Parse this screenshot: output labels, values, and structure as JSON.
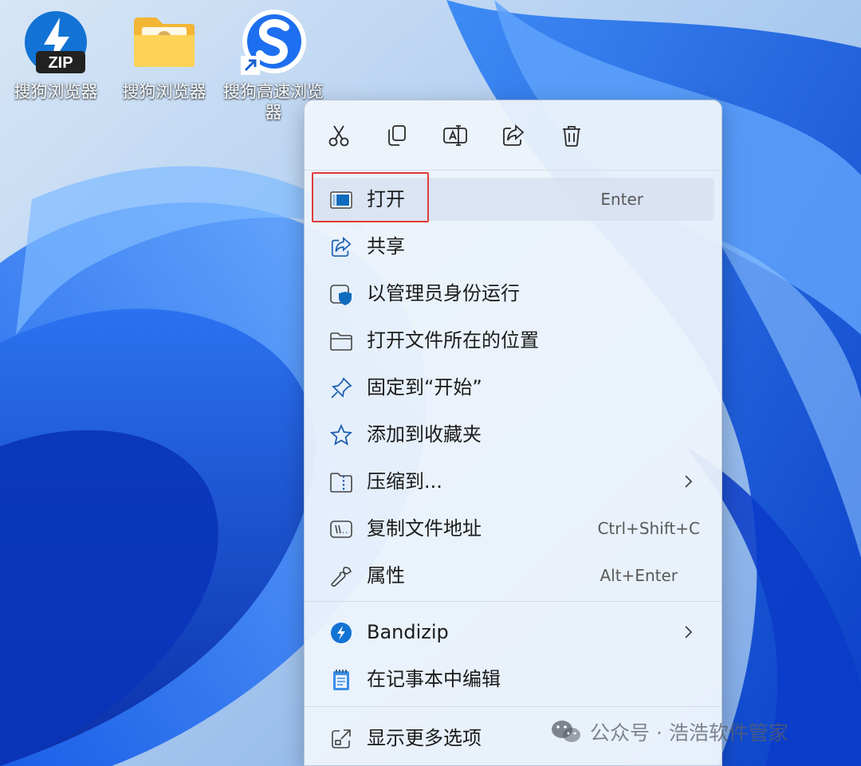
{
  "desktop": {
    "icons": [
      {
        "label": "搜狗浏览器",
        "badge": "ZIP",
        "icon": "bandizip-archive-icon"
      },
      {
        "label": "搜狗浏览器",
        "icon": "folder-icon"
      },
      {
        "label": "搜狗高速浏览器",
        "icon": "sogou-browser-shortcut-icon"
      }
    ]
  },
  "context_menu": {
    "toolbar": [
      {
        "name": "cut",
        "icon": "scissors-icon"
      },
      {
        "name": "copy",
        "icon": "copy-icon"
      },
      {
        "name": "rename",
        "icon": "rename-icon"
      },
      {
        "name": "share",
        "icon": "share-icon"
      },
      {
        "name": "delete",
        "icon": "trash-icon"
      }
    ],
    "items": [
      {
        "label": "打开",
        "shortcut": "Enter",
        "icon": "open-window-icon",
        "highlighted": true
      },
      {
        "label": "共享",
        "icon": "share-icon"
      },
      {
        "label": "以管理员身份运行",
        "icon": "admin-shield-icon"
      },
      {
        "label": "打开文件所在的位置",
        "icon": "folder-outline-icon"
      },
      {
        "label": "固定到“开始”",
        "icon": "pin-icon"
      },
      {
        "label": "添加到收藏夹",
        "icon": "star-icon"
      },
      {
        "label": "压缩到...",
        "icon": "zip-folder-icon",
        "submenu": true
      },
      {
        "label": "复制文件地址",
        "shortcut": "Ctrl+Shift+C",
        "icon": "copy-path-icon"
      },
      {
        "label": "属性",
        "shortcut": "Alt+Enter",
        "icon": "wrench-icon"
      },
      {
        "label": "Bandizip",
        "icon": "bandizip-icon",
        "submenu": true
      },
      {
        "label": "在记事本中编辑",
        "icon": "notepad-icon"
      },
      {
        "label": "显示更多选项",
        "icon": "more-options-icon"
      }
    ]
  },
  "watermark": {
    "text": "公众号 · 浩浩软件管家"
  },
  "colors": {
    "accent": "#0f6cbd",
    "highlight_border": "#e23a3a"
  }
}
